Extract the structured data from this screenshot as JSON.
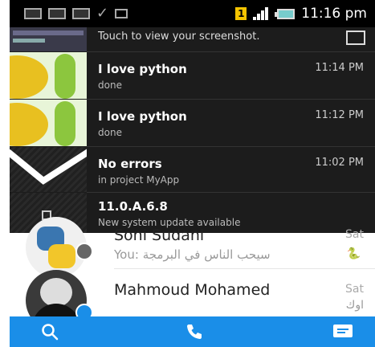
{
  "status_bar": {
    "sim_label": "1",
    "clock": "11:16 pm"
  },
  "notifications": [
    {
      "title": "",
      "subtitle": "Touch to view your screenshot.",
      "time": "",
      "icon": "image-icon"
    },
    {
      "title": "I love python",
      "subtitle": "done",
      "time": "11:14 PM"
    },
    {
      "title": "I love python",
      "subtitle": "done",
      "time": "11:12 PM"
    },
    {
      "title": "No errors",
      "subtitle": "in project MyApp",
      "time": "11:02 PM"
    },
    {
      "title": "11.0.A.6.8",
      "subtitle": "New system update available",
      "time": ""
    }
  ],
  "contacts": [
    {
      "name": "Soni Sudani",
      "message": "You: سيحب الناس في البرمجة",
      "date": "Sat",
      "badge": "facebook-badge"
    },
    {
      "name": "Mahmoud Mohamed",
      "message": "",
      "date": "Sat",
      "message_right": "اوك",
      "badge": "messenger-badge"
    }
  ],
  "bottom_nav": {
    "icons": [
      "search-icon",
      "phone-icon",
      "message-icon"
    ]
  },
  "colors": {
    "nav_blue": "#1a8ee8",
    "shade_bg": "#1c1c1c",
    "sim_yellow": "#f5c400"
  }
}
